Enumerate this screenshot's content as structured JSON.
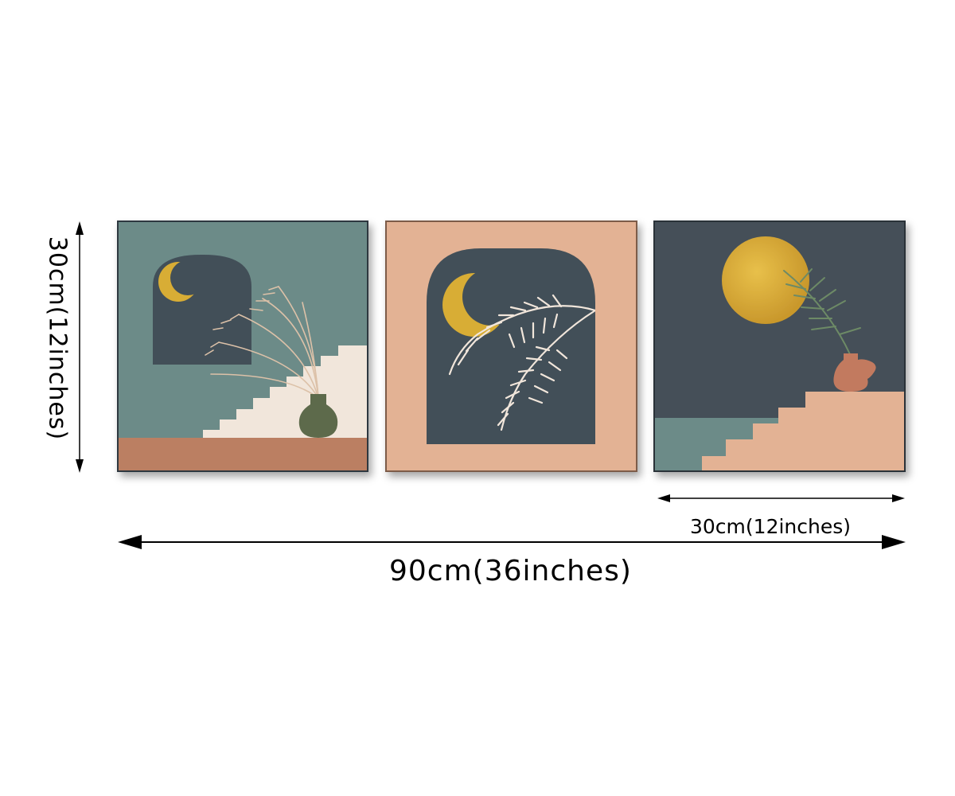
{
  "dimensions": {
    "height_label": "30cm(12inches)",
    "panel_width_label": "30cm(12inches)",
    "total_width_label": "90cm(36inches)"
  },
  "panels": [
    {
      "name": "moon-arch-stairs-panel",
      "background": "#6c8b88"
    },
    {
      "name": "arch-palm-panel",
      "background": "#e3b294"
    },
    {
      "name": "sun-vase-stairs-panel",
      "background": "#444f58"
    }
  ],
  "colors": {
    "slate": "#435059",
    "teal": "#6c8b88",
    "peach": "#e3b294",
    "terracotta": "#bb7f62",
    "gold": "#d8ad35",
    "cream": "#f1e6db",
    "olive": "#5d6b4c"
  }
}
